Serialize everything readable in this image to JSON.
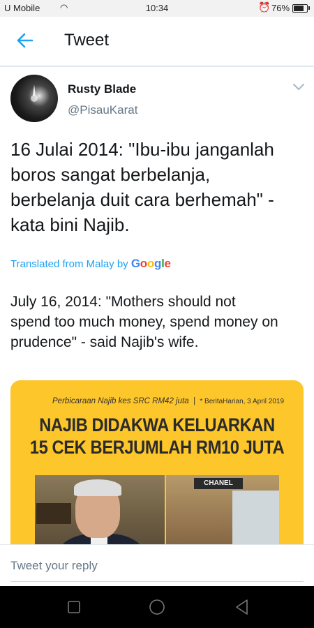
{
  "status_bar": {
    "carrier": "U Mobile",
    "time": "10:34",
    "battery": "76%",
    "battery_level": 0.76
  },
  "header": {
    "title": "Tweet"
  },
  "tweet": {
    "author_name": "Rusty Blade",
    "author_handle": "@PisauKarat",
    "text": "16 Julai 2014: \"Ibu-ibu janganlah\nboros sangat berbelanja,\nberbelanja duit cara berhemah\" -\nkata bini Najib.",
    "translated_from": "Translated from Malay by ",
    "translator": "Google",
    "translation": "July 16, 2014: \"Mothers should not\nspend too much money, spend money on\nprudence\" - said Najib's wife."
  },
  "media": {
    "caption": "Perbicaraan Najib kes SRC RM42 juta",
    "caption_source": "* BeritaHarian, 3 April 2019",
    "headline_line1": "NAJIB DIDAKWA KELUARKAN",
    "headline_line2": "15 CEK BERJUMLAH RM10 JUTA",
    "store_sign": "CHANEL"
  },
  "reply": {
    "placeholder": "Tweet your reply"
  },
  "colors": {
    "accent": "#1da1f2",
    "media_background": "#fdc62b",
    "google": [
      "#4285f4",
      "#ea4335",
      "#fbbc05",
      "#4285f4",
      "#34a853",
      "#ea4335"
    ]
  }
}
